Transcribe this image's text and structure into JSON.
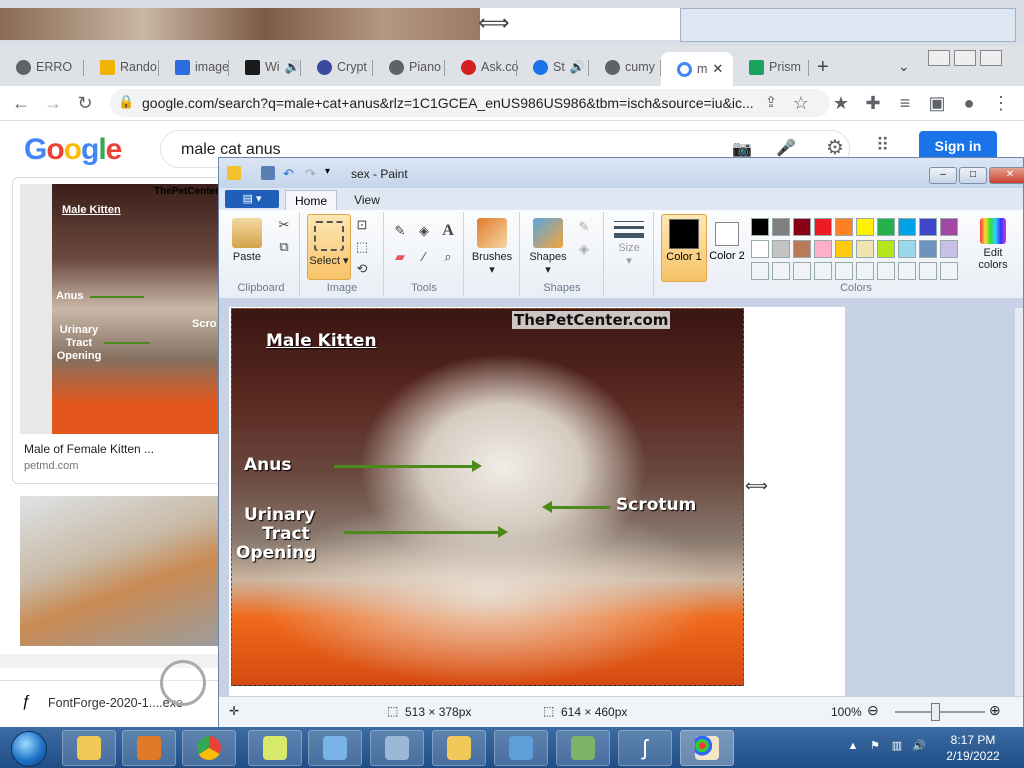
{
  "browser": {
    "tabs": [
      {
        "label": "ERRO",
        "fav": "#5f6368"
      },
      {
        "label": "Rando",
        "fav": "#f0b400"
      },
      {
        "label": "image",
        "fav": "#2d6cdf"
      },
      {
        "label": "Wi",
        "fav": "#1a1a1a"
      },
      {
        "label": "Crypt",
        "fav": "#3a4aa0"
      },
      {
        "label": "Piano",
        "fav": "#5f6368"
      },
      {
        "label": "Ask.co",
        "fav": "#d32020"
      },
      {
        "label": "St",
        "fav": "#1a73e8"
      },
      {
        "label": "cumy",
        "fav": "#5f6368"
      },
      {
        "label": "m",
        "fav": "#4285f4"
      },
      {
        "label": "Prism",
        "fav": "#1aa260"
      }
    ],
    "new_tab": "+",
    "url": "google.com/search?q=male+cat+anus&rlz=1C1GCEA_enUS986US986&tbm=isch&source=iu&ic..."
  },
  "google": {
    "logo": "Google",
    "query": "male cat anus",
    "sign_in": "Sign in",
    "result1": {
      "title": "Male of Female Kitten ...",
      "source": "petmd.com",
      "labels": {
        "brand": "ThePetCenter.",
        "heading": "Male Kitten",
        "anus": "Anus",
        "urinary": "Urinary Tract Opening",
        "scrotum": "Scro"
      }
    },
    "download": {
      "name": "FontForge-2020-1....exe"
    }
  },
  "paint": {
    "title": "sex - Paint",
    "file_menu": "▤ ▾",
    "tabs": {
      "home": "Home",
      "view": "View"
    },
    "groups": {
      "clipboard": "Clipboard",
      "image": "Image",
      "tools": "Tools",
      "shapes": "Shapes",
      "colors": "Colors"
    },
    "buttons": {
      "paste": "Paste",
      "select": "Select",
      "brushes": "Brushes",
      "shapes": "Shapes",
      "size": "Size",
      "color1": "Color 1",
      "color2": "Color 2",
      "edit_colors": "Edit colors"
    },
    "image_labels": {
      "brand": "ThePetCenter.com",
      "heading": "Male Kitten",
      "anus": "Anus",
      "urinary1": "Urinary",
      "urinary2": "Tract",
      "urinary3": "Opening",
      "scrotum": "Scrotum"
    },
    "status": {
      "selection": "513 × 378px",
      "canvas": "614 × 460px",
      "zoom": "100%"
    },
    "palette_row1": [
      "#000000",
      "#7f7f7f",
      "#880015",
      "#ed1c24",
      "#ff7f27",
      "#fff200",
      "#22b14c",
      "#00a2e8",
      "#3f48cc",
      "#a349a4"
    ],
    "palette_row2": [
      "#ffffff",
      "#c3c3c3",
      "#b97a57",
      "#ffaec9",
      "#ffc90e",
      "#efe4b0",
      "#b5e61d",
      "#99d9ea",
      "#7092be",
      "#c8bfe7"
    ]
  },
  "taskbar": {
    "time": "8:17 PM",
    "date": "2/19/2022"
  }
}
